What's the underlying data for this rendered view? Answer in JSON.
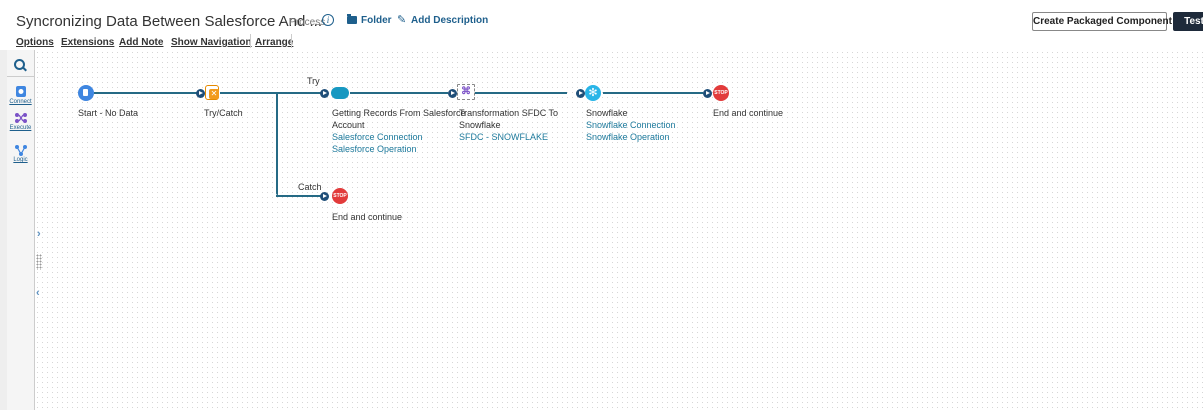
{
  "header": {
    "title": "Syncronizing Data Between Salesforce And ...",
    "subtitle": "- Process",
    "info_icon": "info-icon",
    "folder_label": "Folder",
    "add_description_label": "Add Description",
    "create_packaged_label": "Create Packaged Component",
    "test_label": "Test"
  },
  "menu": {
    "options": "Options",
    "extensions": "Extensions",
    "add_note": "Add Note",
    "show_navigation": "Show Navigation",
    "arrange": "Arrange"
  },
  "sidebar": {
    "items": [
      {
        "label": "Connect",
        "icon": "connect-icon"
      },
      {
        "label": "Execute",
        "icon": "execute-icon"
      },
      {
        "label": "Logic",
        "icon": "logic-icon"
      }
    ]
  },
  "process": {
    "try_label": "Try",
    "catch_label": "Catch",
    "shapes": [
      {
        "name": "Start - No Data",
        "icon": "start-icon"
      },
      {
        "name": "Try/Catch",
        "icon": "try-catch-icon"
      },
      {
        "name": "Getting Records From Salesforce",
        "name2": "Account",
        "sub1": "Salesforce Connection",
        "sub2": "Salesforce Operation",
        "icon": "salesforce-icon"
      },
      {
        "name": "Transformation SFDC To",
        "name2": "Snowflake",
        "sub1": "SFDC - SNOWFLAKE",
        "icon": "map-icon"
      },
      {
        "name": "Snowflake",
        "sub1": "Snowflake Connection",
        "sub2": "Snowflake Operation",
        "icon": "snowflake-icon"
      },
      {
        "name": "End and continue",
        "icon": "stop-icon",
        "badge": "STOP"
      },
      {
        "name": "End and continue",
        "icon": "stop-icon",
        "badge": "STOP"
      }
    ]
  },
  "colors": {
    "accent": "#1e5f8c",
    "connector": "#256a85",
    "stop": "#e23b3b",
    "start": "#3f86e0",
    "salesforce": "#1798c1",
    "snowflake": "#29b5e8",
    "dark_button": "#1e2a3a"
  }
}
